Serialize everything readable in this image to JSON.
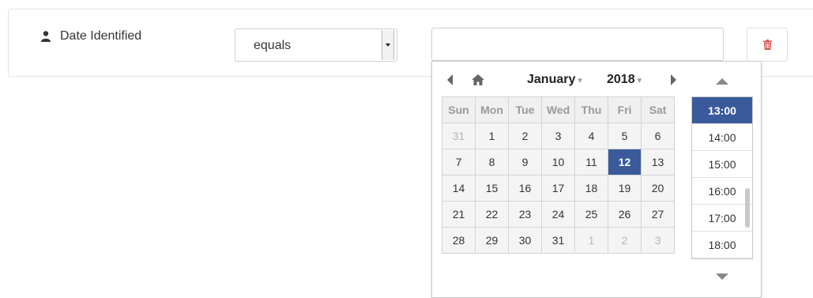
{
  "filter": {
    "field_label": "Date Identified",
    "operator": "equals",
    "value": ""
  },
  "picker": {
    "month": "January",
    "year": "2018",
    "weekdays": [
      "Sun",
      "Mon",
      "Tue",
      "Wed",
      "Thu",
      "Fri",
      "Sat"
    ],
    "weeks": [
      [
        {
          "d": "31",
          "m": true
        },
        {
          "d": "1"
        },
        {
          "d": "2"
        },
        {
          "d": "3"
        },
        {
          "d": "4"
        },
        {
          "d": "5"
        },
        {
          "d": "6"
        }
      ],
      [
        {
          "d": "7"
        },
        {
          "d": "8"
        },
        {
          "d": "9"
        },
        {
          "d": "10"
        },
        {
          "d": "11"
        },
        {
          "d": "12",
          "s": true
        },
        {
          "d": "13"
        }
      ],
      [
        {
          "d": "14"
        },
        {
          "d": "15"
        },
        {
          "d": "16"
        },
        {
          "d": "17"
        },
        {
          "d": "18"
        },
        {
          "d": "19"
        },
        {
          "d": "20"
        }
      ],
      [
        {
          "d": "21"
        },
        {
          "d": "22"
        },
        {
          "d": "23"
        },
        {
          "d": "24"
        },
        {
          "d": "25"
        },
        {
          "d": "26"
        },
        {
          "d": "27"
        }
      ],
      [
        {
          "d": "28"
        },
        {
          "d": "29"
        },
        {
          "d": "30"
        },
        {
          "d": "31"
        },
        {
          "d": "1",
          "m": true
        },
        {
          "d": "2",
          "m": true
        },
        {
          "d": "3",
          "m": true
        }
      ]
    ],
    "times": [
      "13:00",
      "14:00",
      "15:00",
      "16:00",
      "17:00",
      "18:00"
    ],
    "selected_time": "13:00"
  },
  "colors": {
    "accent": "#3a5a9b",
    "delete": "#d9534f"
  },
  "icons": {
    "field": "person-icon",
    "delete": "trash-icon",
    "home": "home-icon"
  }
}
